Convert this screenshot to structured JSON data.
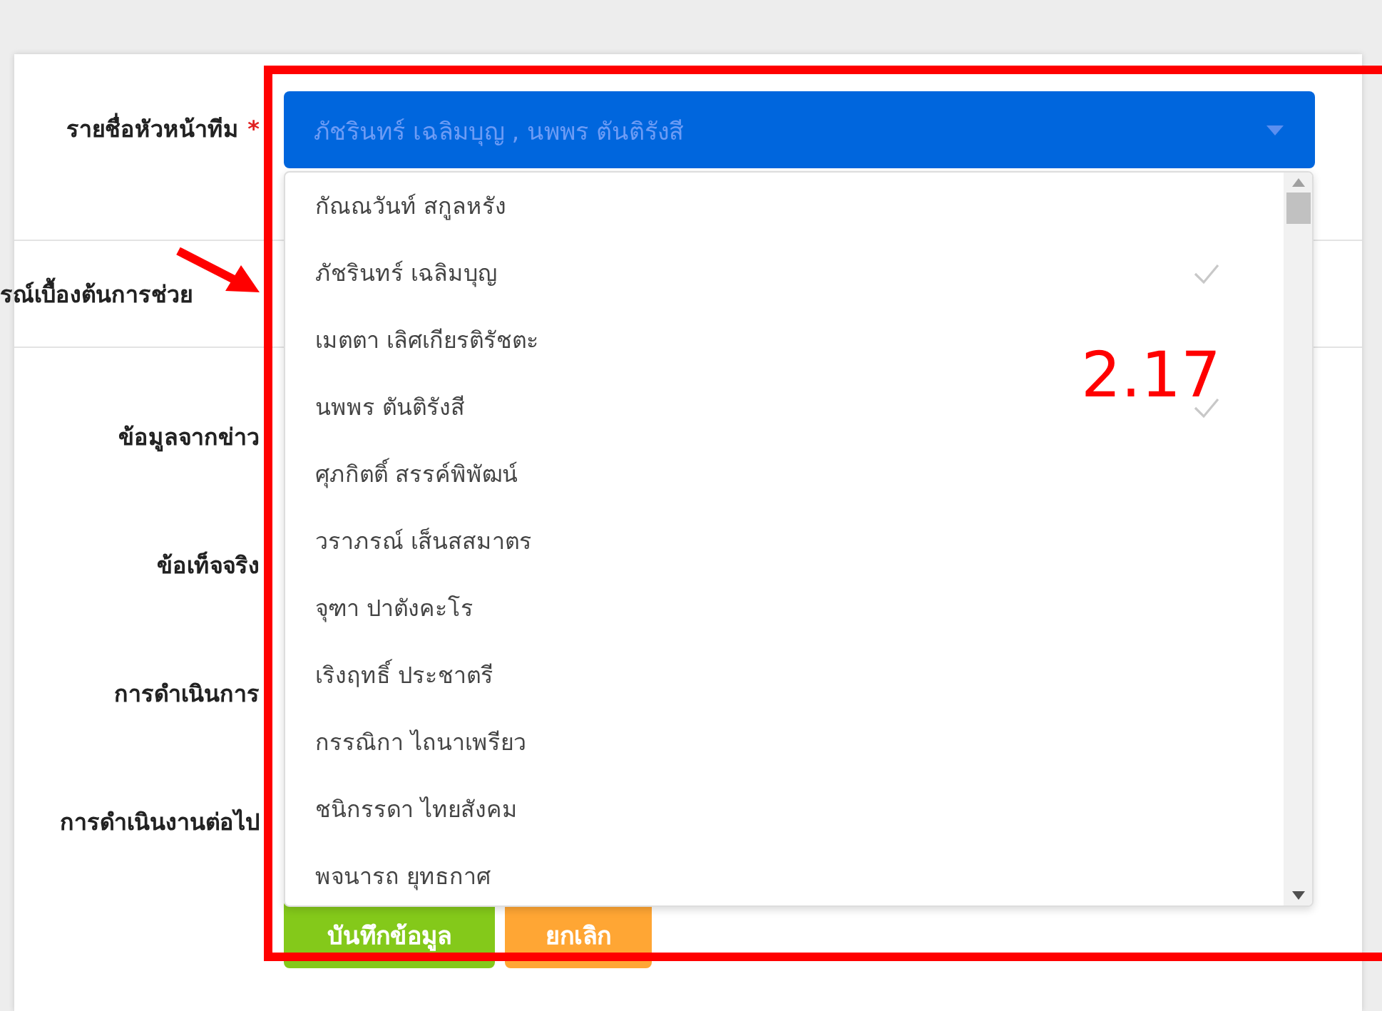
{
  "form": {
    "leader_field": {
      "label": "รายชื่อหัวหน้าทีม",
      "required_mark": "*",
      "value": "ภัชรินทร์ เฉลิมบุญ , นพพร ตันติรังสี",
      "expanded": true,
      "options": [
        {
          "label": "กัณณวันท์ สกูลหรัง",
          "selected": false
        },
        {
          "label": "ภัชรินทร์ เฉลิมบุญ",
          "selected": true
        },
        {
          "label": "เมตตา เลิศเกียรติรัชตะ",
          "selected": false
        },
        {
          "label": "นพพร ตันติรังสี",
          "selected": true
        },
        {
          "label": "ศุภกิตติ์ สรรค์พิพัฒน์",
          "selected": false
        },
        {
          "label": "วราภรณ์ เส็นสสมาตร",
          "selected": false
        },
        {
          "label": "จุฑา ปาตังคะโร",
          "selected": false
        },
        {
          "label": "เริงฤทธิ์ ประชาตรี",
          "selected": false
        },
        {
          "label": "กรรณิกา ไถนาเพรียว",
          "selected": false
        },
        {
          "label": "ชนิกรรดา ไทยสังคม",
          "selected": false
        },
        {
          "label": "พจนารถ ยุทธกาศ",
          "selected": false
        }
      ]
    },
    "section_label": "รณ์เบื้องต้นการช่วย",
    "field_labels": [
      "ข้อมูลจากข่าว",
      "ข้อเท็จจริง",
      "การดำเนินการ",
      "การดำเนินงานต่อไป"
    ],
    "buttons": [
      {
        "label": "บันทึกข้อมูล",
        "kind": "save"
      },
      {
        "label": "ยกเลิก",
        "kind": "cancel"
      }
    ]
  },
  "annotation": {
    "label": "2.17"
  }
}
